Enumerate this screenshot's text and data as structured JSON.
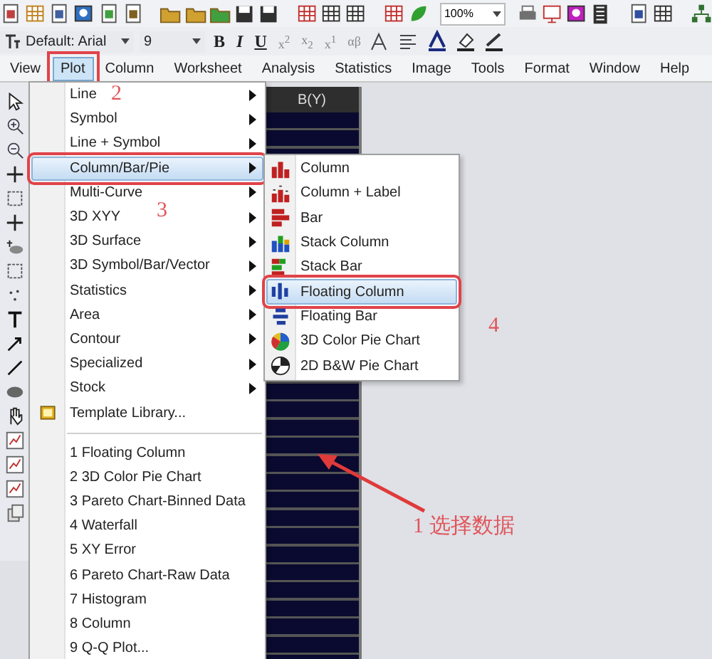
{
  "toolbar": {
    "zoom": "100%"
  },
  "format_bar": {
    "font": "Default: Arial",
    "size": "9",
    "buttons": [
      "B",
      "I",
      "U",
      "x$^{2}$",
      "x$_{2}$",
      "x$^{1}$",
      "αβ"
    ]
  },
  "menu_bar": [
    {
      "label": "View",
      "selected": false
    },
    {
      "label": "Plot",
      "selected": true
    },
    {
      "label": "Column",
      "selected": false
    },
    {
      "label": "Worksheet",
      "selected": false
    },
    {
      "label": "Analysis",
      "selected": false
    },
    {
      "label": "Statistics",
      "selected": false
    },
    {
      "label": "Image",
      "selected": false
    },
    {
      "label": "Tools",
      "selected": false
    },
    {
      "label": "Format",
      "selected": false
    },
    {
      "label": "Window",
      "selected": false
    },
    {
      "label": "Help",
      "selected": false
    }
  ],
  "worksheet": {
    "column_header": "B(Y)"
  },
  "plot_menu": {
    "items": [
      {
        "label": "Line",
        "kind": "submenu",
        "selected": false
      },
      {
        "label": "Symbol",
        "kind": "submenu",
        "selected": false
      },
      {
        "label": "Line + Symbol",
        "kind": "submenu",
        "selected": false
      },
      {
        "label": "Column/Bar/Pie",
        "kind": "submenu",
        "selected": true
      },
      {
        "label": "Multi-Curve",
        "kind": "submenu",
        "selected": false
      },
      {
        "label": "3D XYY",
        "kind": "submenu",
        "selected": false
      },
      {
        "label": "3D Surface",
        "kind": "submenu",
        "selected": false
      },
      {
        "label": "3D Symbol/Bar/Vector",
        "kind": "submenu",
        "selected": false
      },
      {
        "label": "Statistics",
        "kind": "submenu",
        "selected": false
      },
      {
        "label": "Area",
        "kind": "submenu",
        "selected": false
      },
      {
        "label": "Contour",
        "kind": "submenu",
        "selected": false
      },
      {
        "label": "Specialized",
        "kind": "submenu",
        "selected": false
      },
      {
        "label": "Stock",
        "kind": "submenu",
        "selected": false
      },
      {
        "label": "Template Library...",
        "kind": "template",
        "selected": false
      },
      {
        "kind": "separator"
      },
      {
        "label": "1 Floating Column",
        "kind": "command",
        "selected": false
      },
      {
        "label": "2 3D Color Pie Chart",
        "kind": "command",
        "selected": false
      },
      {
        "label": "3 Pareto Chart-Binned Data",
        "kind": "command",
        "selected": false
      },
      {
        "label": "4 Waterfall",
        "kind": "command",
        "selected": false
      },
      {
        "label": "5 XY Error",
        "kind": "command",
        "selected": false
      },
      {
        "label": "6 Pareto Chart-Raw Data",
        "kind": "command",
        "selected": false
      },
      {
        "label": "7 Histogram",
        "kind": "command",
        "selected": false
      },
      {
        "label": "8 Column",
        "kind": "command",
        "selected": false
      },
      {
        "label": "9 Q-Q Plot...",
        "kind": "command",
        "selected": false
      }
    ]
  },
  "submenu": {
    "items": [
      {
        "label": "Column",
        "kind": "column",
        "selected": false
      },
      {
        "label": "Column + Label",
        "kind": "column-label",
        "selected": false
      },
      {
        "label": "Bar",
        "kind": "bar",
        "selected": false
      },
      {
        "label": "Stack Column",
        "kind": "stack-column",
        "selected": false
      },
      {
        "label": "Stack Bar",
        "kind": "stack-bar",
        "selected": false
      },
      {
        "label": "Floating Column",
        "kind": "floating-column",
        "selected": true
      },
      {
        "label": "Floating Bar",
        "kind": "floating-bar",
        "selected": false
      },
      {
        "label": "3D Color Pie Chart",
        "kind": "color-pie",
        "selected": false
      },
      {
        "label": "2D B&W Pie Chart",
        "kind": "bw-pie",
        "selected": false
      }
    ]
  },
  "annotations": [
    {
      "text": "2"
    },
    {
      "text": "3"
    },
    {
      "text": "4"
    },
    {
      "text": "1 选择数据"
    }
  ]
}
